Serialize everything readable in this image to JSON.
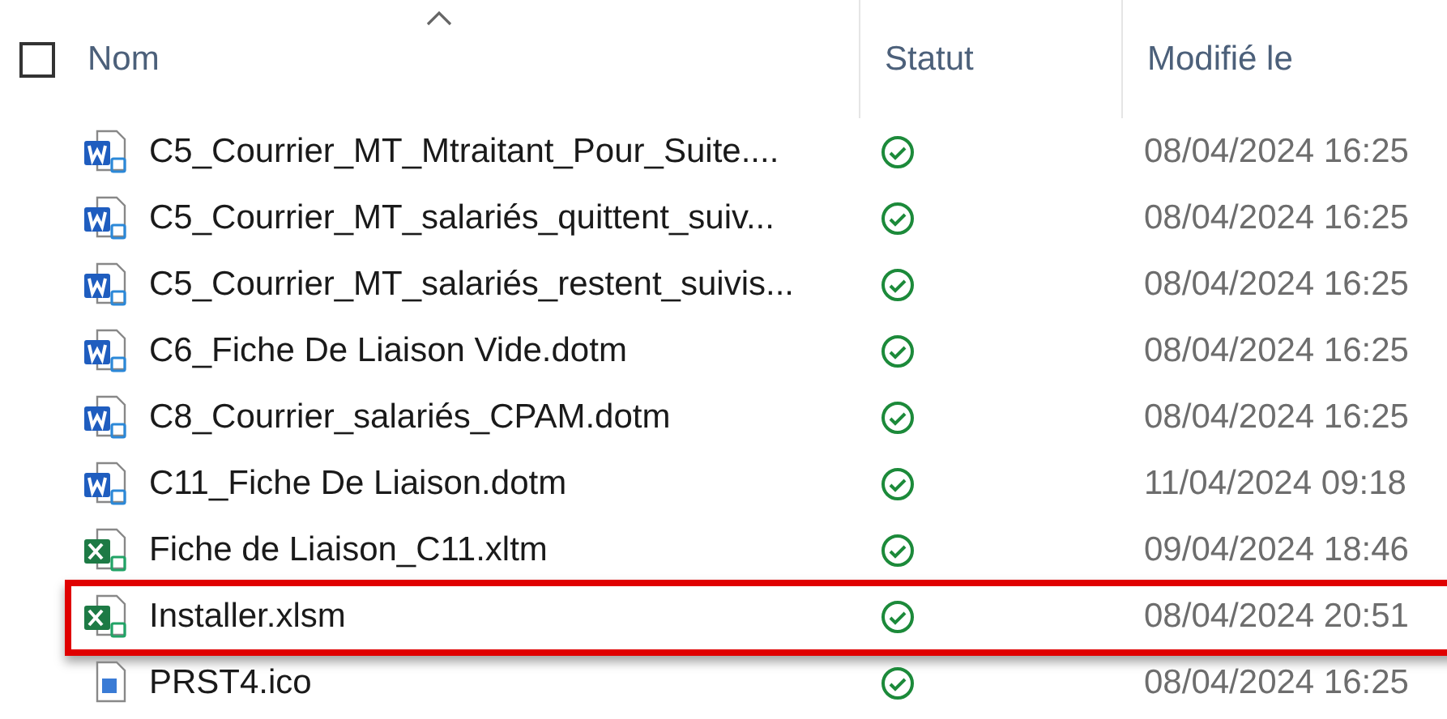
{
  "header": {
    "select_all": {
      "checked": false
    },
    "sort_ascending": true,
    "columns": [
      {
        "label": "Nom"
      },
      {
        "label": "Statut"
      },
      {
        "label": "Modifié le"
      }
    ]
  },
  "rows": [
    {
      "kind": "word",
      "name": "C5_Courrier_MT_Mtraitant_Pour_Suite....",
      "synced": true,
      "modified": "08/04/2024 16:25",
      "highlighted": false
    },
    {
      "kind": "word",
      "name": "C5_Courrier_MT_salariés_quittent_suiv...",
      "synced": true,
      "modified": "08/04/2024 16:25",
      "highlighted": false
    },
    {
      "kind": "word",
      "name": "C5_Courrier_MT_salariés_restent_suivis...",
      "synced": true,
      "modified": "08/04/2024 16:25",
      "highlighted": false
    },
    {
      "kind": "word",
      "name": "C6_Fiche De Liaison Vide.dotm",
      "synced": true,
      "modified": "08/04/2024 16:25",
      "highlighted": false
    },
    {
      "kind": "word",
      "name": "C8_Courrier_salariés_CPAM.dotm",
      "synced": true,
      "modified": "08/04/2024 16:25",
      "highlighted": false
    },
    {
      "kind": "word",
      "name": "C11_Fiche De Liaison.dotm",
      "synced": true,
      "modified": "11/04/2024 09:18",
      "highlighted": false
    },
    {
      "kind": "excel",
      "name": "Fiche de Liaison_C11.xltm",
      "synced": true,
      "modified": "09/04/2024 18:46",
      "highlighted": false
    },
    {
      "kind": "excel",
      "name": "Installer.xlsm",
      "synced": true,
      "modified": "08/04/2024 20:51",
      "highlighted": true
    },
    {
      "kind": "image",
      "name": "PRST4.ico",
      "synced": true,
      "modified": "08/04/2024 16:25",
      "highlighted": false
    }
  ]
}
